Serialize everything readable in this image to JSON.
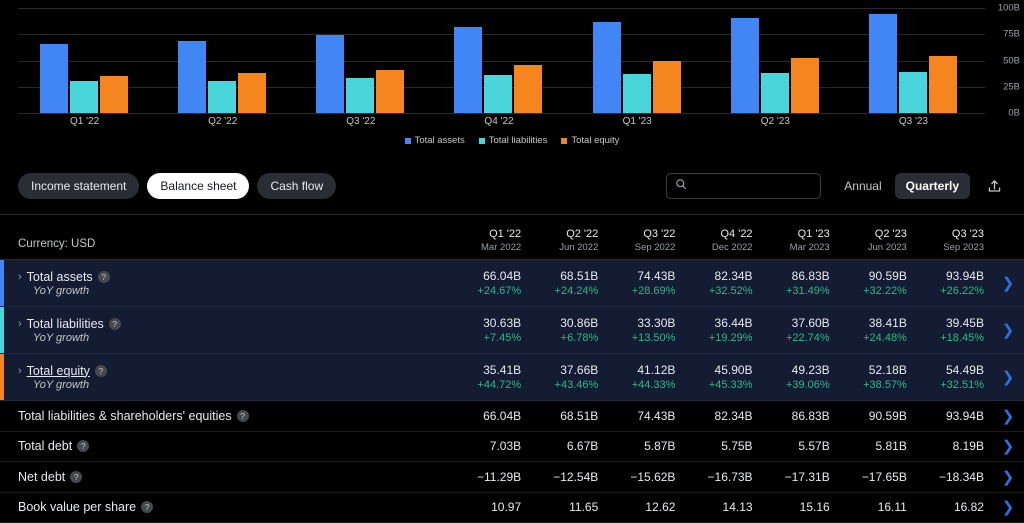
{
  "chart_data": {
    "type": "bar",
    "title": "",
    "xlabel": "",
    "ylabel": "",
    "ylim": [
      0,
      100
    ],
    "yticks": [
      "0B",
      "25B",
      "50B",
      "75B",
      "100B"
    ],
    "categories": [
      "Q1 '22",
      "Q2 '22",
      "Q3 '22",
      "Q4 '22",
      "Q1 '23",
      "Q2 '23",
      "Q3 '23"
    ],
    "legend_position": "bottom",
    "grid": true,
    "series": [
      {
        "name": "Total assets",
        "color": "#4285f4",
        "values": [
          66.04,
          68.51,
          74.43,
          82.34,
          86.83,
          90.59,
          93.94
        ]
      },
      {
        "name": "Total liabilities",
        "color": "#4ad5db",
        "values": [
          30.63,
          30.86,
          33.3,
          36.44,
          37.6,
          38.41,
          39.45
        ]
      },
      {
        "name": "Total equity",
        "color": "#f5861f",
        "values": [
          35.41,
          37.66,
          41.12,
          45.9,
          49.23,
          52.18,
          54.49
        ]
      }
    ]
  },
  "toolbar": {
    "statements": [
      {
        "label": "Income statement",
        "active": false
      },
      {
        "label": "Balance sheet",
        "active": true
      },
      {
        "label": "Cash flow",
        "active": false
      }
    ],
    "search": {
      "value": "",
      "placeholder": ""
    },
    "period": [
      {
        "label": "Annual",
        "active": false
      },
      {
        "label": "Quarterly",
        "active": true
      }
    ],
    "export_icon": "export-upload-icon"
  },
  "table": {
    "currency_label": "Currency: USD",
    "columns": [
      {
        "quarter": "Q1 '22",
        "month": "Mar 2022"
      },
      {
        "quarter": "Q2 '22",
        "month": "Jun 2022"
      },
      {
        "quarter": "Q3 '22",
        "month": "Sep 2022"
      },
      {
        "quarter": "Q4 '22",
        "month": "Dec 2022"
      },
      {
        "quarter": "Q1 '23",
        "month": "Mar 2023"
      },
      {
        "quarter": "Q2 '23",
        "month": "Jun 2023"
      },
      {
        "quarter": "Q3 '23",
        "month": "Sep 2023"
      }
    ],
    "growth_rows": [
      {
        "label": "Total assets",
        "sub_label": "YoY growth",
        "accent": "#4285f4",
        "underlined": false,
        "values": [
          "66.04B",
          "68.51B",
          "74.43B",
          "82.34B",
          "86.83B",
          "90.59B",
          "93.94B"
        ],
        "growth": [
          "+24.67%",
          "+24.24%",
          "+28.69%",
          "+32.52%",
          "+31.49%",
          "+32.22%",
          "+26.22%"
        ]
      },
      {
        "label": "Total liabilities",
        "sub_label": "YoY growth",
        "accent": "#4ad5db",
        "underlined": false,
        "values": [
          "30.63B",
          "30.86B",
          "33.30B",
          "36.44B",
          "37.60B",
          "38.41B",
          "39.45B"
        ],
        "growth": [
          "+7.45%",
          "+6.78%",
          "+13.50%",
          "+19.29%",
          "+22.74%",
          "+24.48%",
          "+18.45%"
        ]
      },
      {
        "label": "Total equity",
        "sub_label": "YoY growth",
        "accent": "#f5861f",
        "underlined": true,
        "values": [
          "35.41B",
          "37.66B",
          "41.12B",
          "45.90B",
          "49.23B",
          "52.18B",
          "54.49B"
        ],
        "growth": [
          "+44.72%",
          "+43.46%",
          "+44.33%",
          "+45.33%",
          "+39.06%",
          "+38.57%",
          "+32.51%"
        ]
      }
    ],
    "plain_rows": [
      {
        "label": "Total liabilities & shareholders' equities",
        "values": [
          "66.04B",
          "68.51B",
          "74.43B",
          "82.34B",
          "86.83B",
          "90.59B",
          "93.94B"
        ]
      },
      {
        "label": "Total debt",
        "values": [
          "7.03B",
          "6.67B",
          "5.87B",
          "5.75B",
          "5.57B",
          "5.81B",
          "8.19B"
        ]
      },
      {
        "label": "Net debt",
        "values": [
          "−11.29B",
          "−12.54B",
          "−15.62B",
          "−16.73B",
          "−17.31B",
          "−17.65B",
          "−18.34B"
        ]
      },
      {
        "label": "Book value per share",
        "values": [
          "10.97",
          "11.65",
          "12.62",
          "14.13",
          "15.16",
          "16.11",
          "16.82"
        ]
      }
    ],
    "help_icon": "?",
    "expand_icon": "›",
    "row_chevron_icon": "❯"
  }
}
